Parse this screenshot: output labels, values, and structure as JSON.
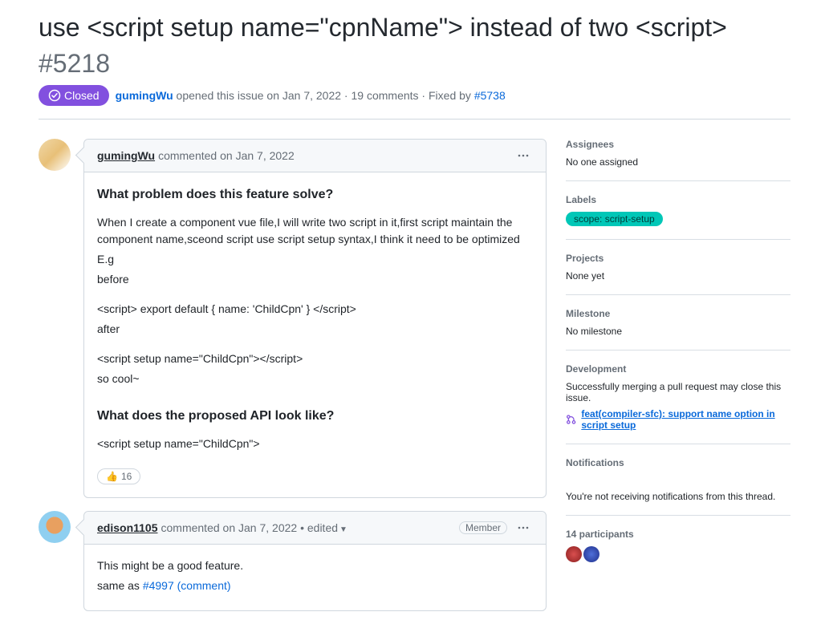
{
  "issue": {
    "title": "use <script setup name=\"cpnName\"> instead of two <script>",
    "number": "#5218",
    "state": "Closed",
    "author": "gumingWu",
    "opened_text": "opened this issue",
    "opened_date": "on Jan 7, 2022",
    "comments_count": "19 comments",
    "fixed_by_text": "Fixed by",
    "fixed_by_link": "#5738"
  },
  "comments": [
    {
      "author": "gumingWu",
      "action": "commented",
      "date": "on Jan 7, 2022",
      "role": "",
      "edited": false,
      "body": {
        "h1": "What problem does this feature solve?",
        "p1": "When I create a component vue file,I will write two script in it,first script maintain the component name,sceond script use script setup syntax,I think it need to be optimized",
        "p2": "E.g",
        "p3": "before",
        "p4": "<script> export default { name: 'ChildCpn' } </script>",
        "p5": "after",
        "p6": "<script setup name=\"ChildCpn\"></script>",
        "p7": "so cool~",
        "h2": "What does the proposed API look like?",
        "p8": "<script setup name=\"ChildCpn\">"
      },
      "reaction": {
        "emoji": "👍",
        "count": "16"
      }
    },
    {
      "author": "edison1105",
      "action": "commented",
      "date": "on Jan 7, 2022",
      "role": "Member",
      "edited": true,
      "edited_label": "edited",
      "body": {
        "line1": "This might be a good feature.",
        "line2_prefix": "same as ",
        "line2_link": "#4997 (comment)"
      }
    }
  ],
  "sidebar": {
    "assignees": {
      "title": "Assignees",
      "value": "No one assigned"
    },
    "labels": {
      "title": "Labels",
      "chip": "scope: script-setup"
    },
    "projects": {
      "title": "Projects",
      "value": "None yet"
    },
    "milestone": {
      "title": "Milestone",
      "value": "No milestone"
    },
    "development": {
      "title": "Development",
      "success": "Successfully merging a pull request may close this issue.",
      "link": "feat(compiler-sfc): support name option in script setup"
    },
    "notifications": {
      "title": "Notifications",
      "note": "You're not receiving notifications from this thread."
    },
    "participants": {
      "title": "14 participants"
    }
  }
}
